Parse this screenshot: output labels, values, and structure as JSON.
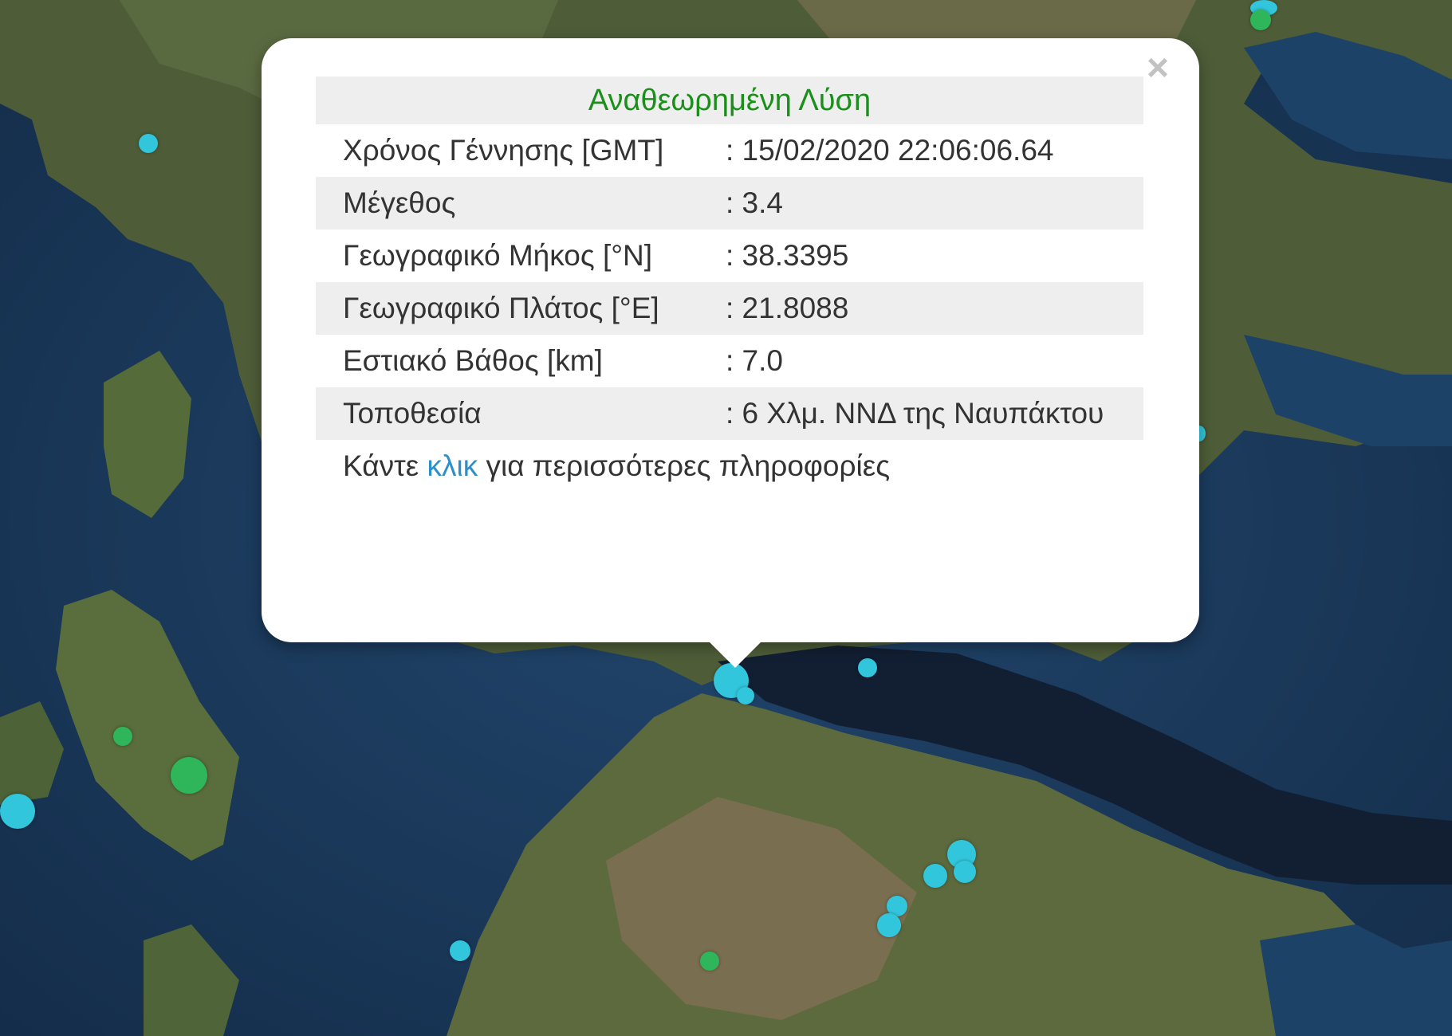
{
  "popup": {
    "title": "Αναθεωρημένη Λύση",
    "close_icon": "×",
    "rows": [
      {
        "label": "Χρόνος Γέννησης [GMT]",
        "value": ": 15/02/2020 22:06:06.64"
      },
      {
        "label": "Μέγεθος",
        "value": ": 3.4"
      },
      {
        "label": "Γεωγραφικό Μήκος [°N]",
        "value": ": 38.3395"
      },
      {
        "label": "Γεωγραφικό Πλάτος [°E]",
        "value": ": 21.8088"
      },
      {
        "label": "Εστιακό Βάθος [km]",
        "value": ": 7.0"
      },
      {
        "label": "Τοποθεσία",
        "value": ": 6 Χλμ. ΝΝΔ της Ναυπάκτου"
      }
    ],
    "footer": {
      "before": "Κάντε ",
      "link": "κλικ",
      "after": " για περισσότερες πληροφορίες"
    }
  },
  "colors": {
    "title": "#1a8f1a",
    "link": "#2c8fc9",
    "marker_recent": "#32c6dc",
    "marker_older": "#2fb55a",
    "sea": "#1b3a5c",
    "land": "#4a5a36"
  }
}
